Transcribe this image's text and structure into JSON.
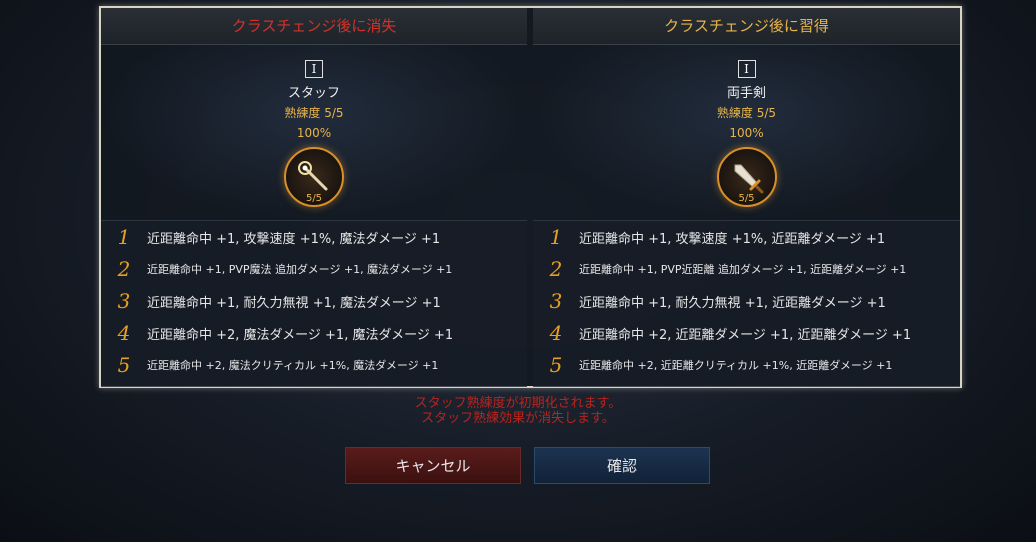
{
  "left_panel": {
    "header": "クラスチェンジ後に消失",
    "tier": "I",
    "weapon_name": "スタッフ",
    "proficiency": "熟練度 5/5",
    "percent": "100%",
    "ring_label": "5/5",
    "weapon_icon": "staff-icon",
    "effects": [
      {
        "num": "1",
        "text": "近距離命中 +1, 攻撃速度 +1%, 魔法ダメージ +1"
      },
      {
        "num": "2",
        "text": "近距離命中 +1, PVP魔法 追加ダメージ +1, 魔法ダメージ +1"
      },
      {
        "num": "3",
        "text": "近距離命中 +1, 耐久力無視 +1, 魔法ダメージ +1"
      },
      {
        "num": "4",
        "text": "近距離命中 +2, 魔法ダメージ +1, 魔法ダメージ +1"
      },
      {
        "num": "5",
        "text": "近距離命中 +2, 魔法クリティカル +1%, 魔法ダメージ +1"
      }
    ]
  },
  "right_panel": {
    "header": "クラスチェンジ後に習得",
    "tier": "I",
    "weapon_name": "両手剣",
    "proficiency": "熟練度 5/5",
    "percent": "100%",
    "ring_label": "5/5",
    "weapon_icon": "sword-icon",
    "effects": [
      {
        "num": "1",
        "text": "近距離命中 +1, 攻撃速度 +1%, 近距離ダメージ +1"
      },
      {
        "num": "2",
        "text": "近距離命中 +1, PVP近距離 追加ダメージ +1, 近距離ダメージ +1"
      },
      {
        "num": "3",
        "text": "近距離命中 +1, 耐久力無視 +1, 近距離ダメージ +1"
      },
      {
        "num": "4",
        "text": "近距離命中 +2, 近距離ダメージ +1, 近距離ダメージ +1"
      },
      {
        "num": "5",
        "text": "近距離命中 +2, 近距離クリティカル +1%, 近距離ダメージ +1"
      }
    ]
  },
  "warning": {
    "line1": "スタッフ熟練度が初期化されます。",
    "line2": "スタッフ熟練効果が消失します。"
  },
  "buttons": {
    "cancel": "キャンセル",
    "confirm": "確認"
  },
  "colors": {
    "lost_header": "#d2322a",
    "gain_header": "#e8b44a",
    "accent_orange": "#e8a020",
    "warning": "#b8241e"
  }
}
